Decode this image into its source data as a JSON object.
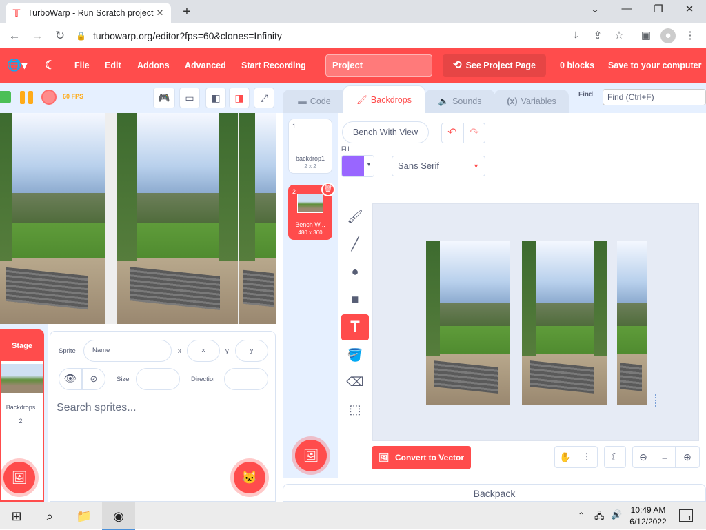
{
  "browser": {
    "tab_title": "TurboWarp - Run Scratch project",
    "url": "turbowarp.org/editor?fps=60&clones=Infinity"
  },
  "menu": {
    "file": "File",
    "edit": "Edit",
    "addons": "Addons",
    "advanced": "Advanced",
    "start_recording": "Start Recording",
    "project_title": "Project",
    "see_project_page": "See Project Page",
    "blocks_count": "0 blocks",
    "save": "Save to your computer"
  },
  "stage": {
    "fps": "60 FPS"
  },
  "target_pane": {
    "stage_label": "Stage",
    "backdrops_label": "Backdrops",
    "backdrops_count": "2",
    "sprite_label": "Sprite",
    "name_placeholder": "Name",
    "x_label": "x",
    "x_placeholder": "x",
    "y_label": "y",
    "y_placeholder": "y",
    "size_label": "Size",
    "direction_label": "Direction",
    "search_placeholder": "Search sprites..."
  },
  "editor_tabs": {
    "code": "Code",
    "backdrops": "Backdrops",
    "sounds": "Sounds",
    "variables": "Variables",
    "find_label": "Find",
    "find_placeholder": "Find (Ctrl+F)"
  },
  "costumes": [
    {
      "index": "1",
      "name": "backdrop1",
      "size": "2 x 2"
    },
    {
      "index": "2",
      "name": "Bench W...",
      "size": "480 x 360"
    }
  ],
  "paint": {
    "costume_name": "Bench With View",
    "fill_label": "Fill",
    "fill_color": "#9966ff",
    "font": "Sans Serif",
    "convert_button": "Convert to Vector",
    "zoom_reset": "="
  },
  "backpack": "Backpack",
  "taskbar": {
    "time": "10:49 AM",
    "date": "6/12/2022",
    "notification_count": "1"
  },
  "colors": {
    "accent": "#ff4c4c",
    "pane_bg": "#e6f0ff"
  }
}
